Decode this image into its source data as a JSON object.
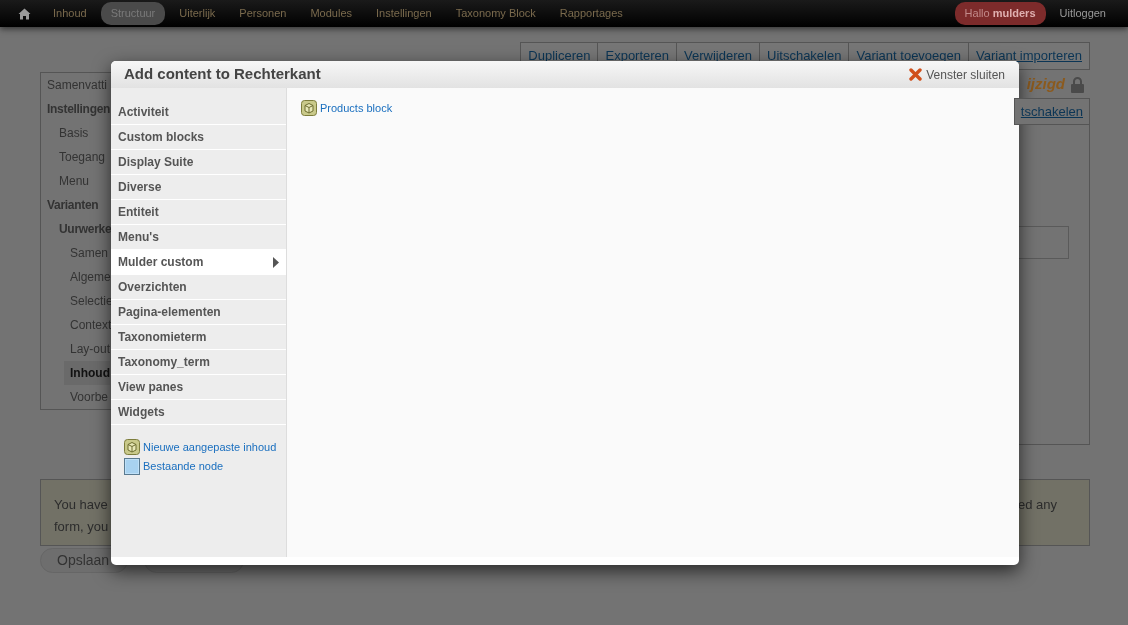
{
  "toolbar": {
    "items": [
      {
        "label": "Inhoud",
        "selected": false
      },
      {
        "label": "Structuur",
        "selected": true
      },
      {
        "label": "Uiterlijk",
        "selected": false
      },
      {
        "label": "Personen",
        "selected": false
      },
      {
        "label": "Modules",
        "selected": false
      },
      {
        "label": "Instellingen",
        "selected": false
      },
      {
        "label": "Taxonomy Block",
        "selected": false
      },
      {
        "label": "Rapportages",
        "selected": false
      }
    ],
    "greeting": "Hallo **mulders**",
    "logout": "Uitloggen"
  },
  "page": {
    "actions": [
      "Dupliceren",
      "Exporteren",
      "Verwijderen",
      "Uitschakelen",
      "Variant toevoegen",
      "Variant importeren"
    ],
    "status": "ijzigd",
    "locked": true,
    "tab": "tschakelen",
    "nav": [
      {
        "label": "Samenvatti",
        "selected": false
      },
      {
        "label": "Instellingen",
        "selected": false,
        "children": [
          {
            "label": "Basis",
            "selected": false
          },
          {
            "label": "Toegang",
            "selected": false
          },
          {
            "label": "Menu",
            "selected": false
          }
        ]
      },
      {
        "label": "Varianten",
        "selected": false,
        "children": [
          {
            "label": "Uurwerke",
            "selected": false,
            "children": [
              {
                "label": "Samen",
                "selected": false
              },
              {
                "label": "Algeme",
                "selected": false
              },
              {
                "label": "Selectie",
                "selected": false
              },
              {
                "label": "Context",
                "selected": false
              },
              {
                "label": "Lay-out",
                "selected": false
              },
              {
                "label": "Inhoud",
                "selected": true
              },
              {
                "label": "Voorbe",
                "selected": false
              }
            ]
          }
        ]
      }
    ],
    "message": {
      "line_1_start": "You have",
      "line_2_start": "form, you",
      "line_1_end": "ed any"
    },
    "buttons": [
      {
        "kind": "labeled",
        "label": "Opslaan"
      },
      {
        "kind": "blank"
      }
    ]
  },
  "dialog": {
    "title": "Add content to Rechterkant",
    "close": "Venster sluiten",
    "categories": [
      {
        "label": "Activiteit",
        "selected": false
      },
      {
        "label": "Custom blocks",
        "selected": false
      },
      {
        "label": "Display Suite",
        "selected": false
      },
      {
        "label": "Diverse",
        "selected": false
      },
      {
        "label": "Entiteit",
        "selected": false
      },
      {
        "label": "Menu's",
        "selected": false
      },
      {
        "label": "Mulder custom",
        "selected": true
      },
      {
        "label": "Overzichten",
        "selected": false
      },
      {
        "label": "Pagina-elementen",
        "selected": false
      },
      {
        "label": "Taxonomieterm",
        "selected": false
      },
      {
        "label": "Taxonomy_term",
        "selected": false
      },
      {
        "label": "View panes",
        "selected": false
      },
      {
        "label": "Widgets",
        "selected": false
      }
    ],
    "extra_links": [
      {
        "label": "Nieuwe aangepaste inhoud",
        "kind": "block"
      },
      {
        "label": "Bestaande node",
        "kind": "node"
      }
    ],
    "content": [
      {
        "label": "Products block",
        "kind": "block"
      }
    ]
  }
}
